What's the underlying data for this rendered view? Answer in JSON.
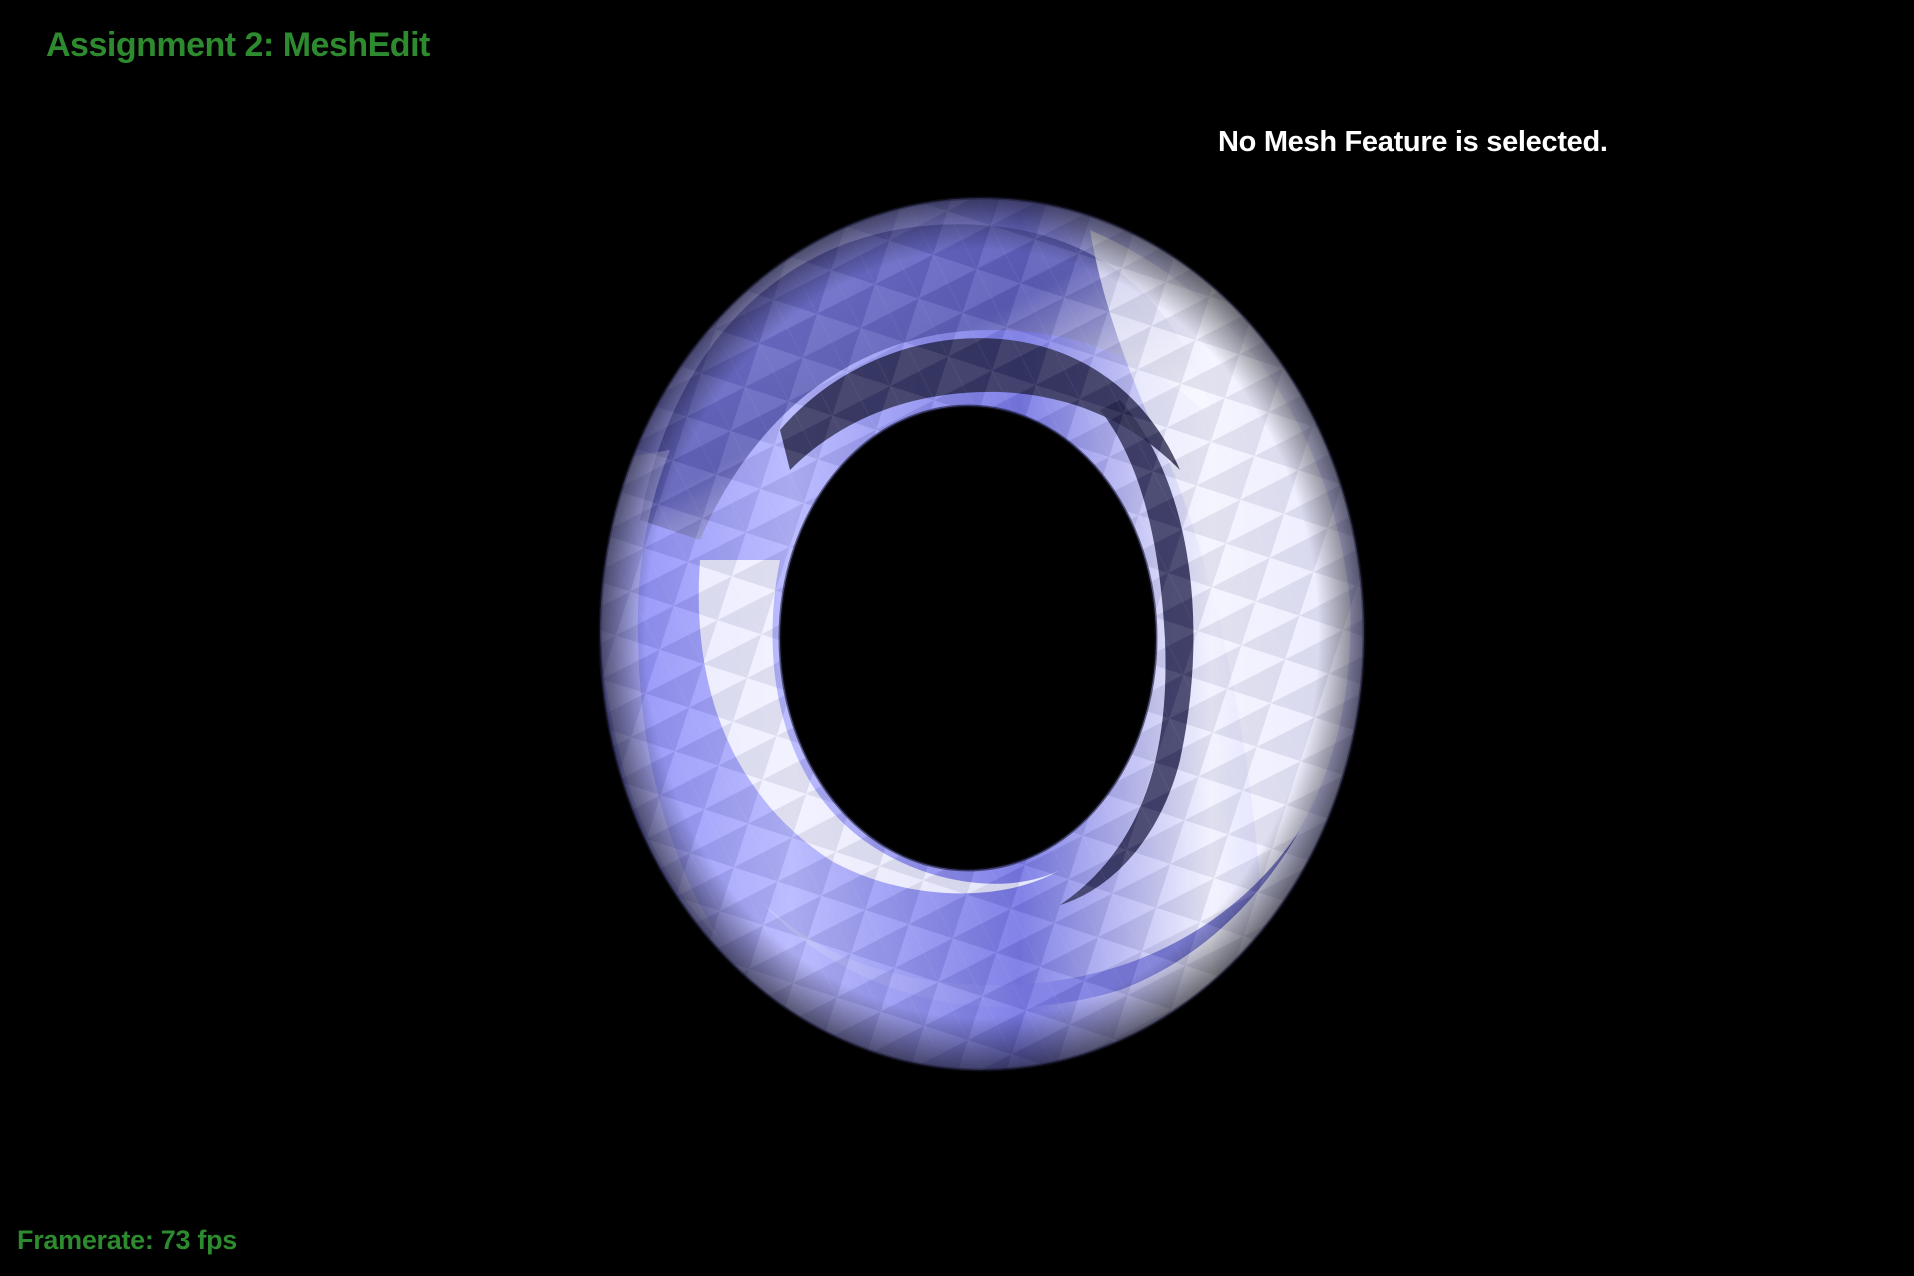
{
  "app": {
    "title": "Assignment 2: MeshEdit"
  },
  "selection": {
    "status_text": "No Mesh Feature is selected."
  },
  "stats": {
    "framerate_label": "Framerate:",
    "framerate_value": "73 fps"
  },
  "scene": {
    "object": "torus-mesh",
    "colors": {
      "background": "#000000",
      "hud_text": "#2e8a2e",
      "status_text": "#ffffff",
      "mesh_light": "#ffffff",
      "mesh_base": "#8c8cff",
      "mesh_shadow": "#20203a"
    }
  }
}
